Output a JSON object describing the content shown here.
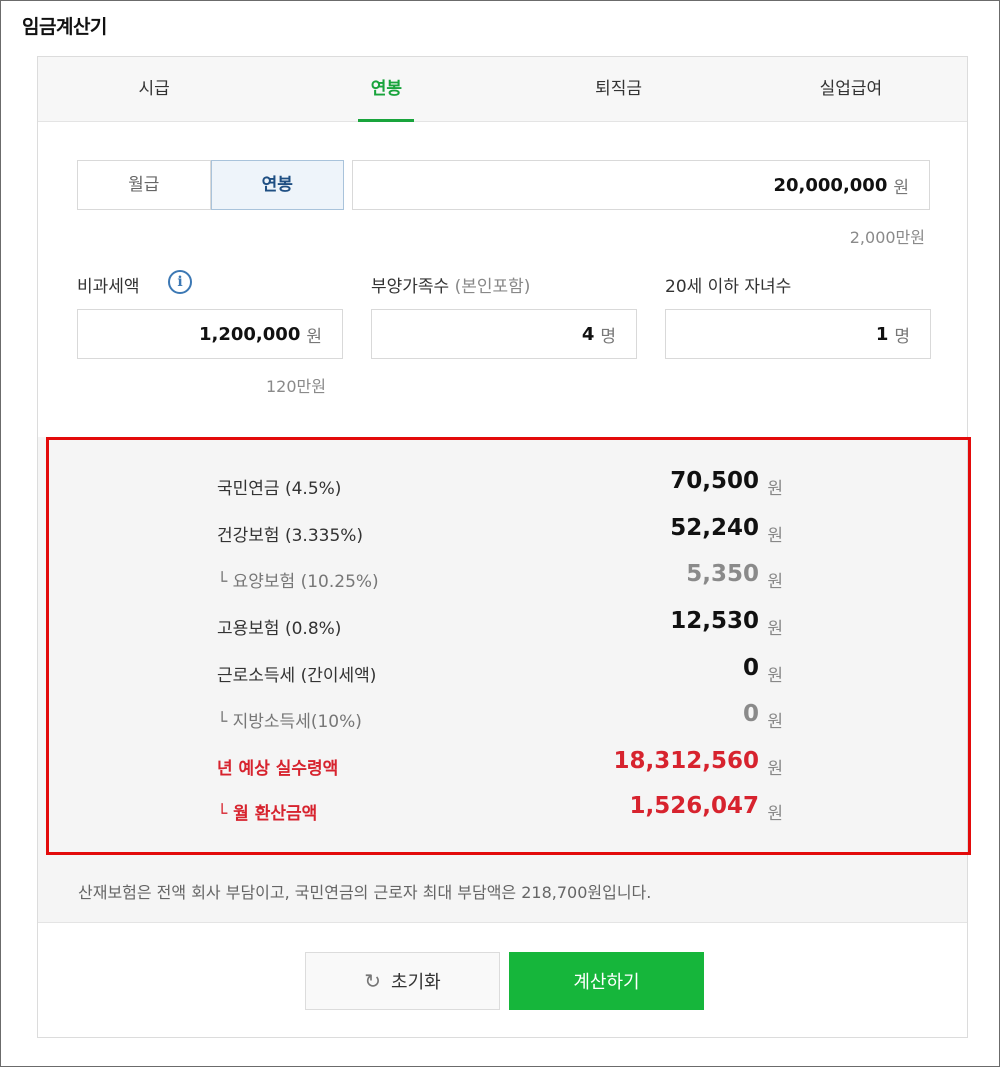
{
  "app_title": "임금계산기",
  "tabs": [
    {
      "label": "시급"
    },
    {
      "label": "연봉"
    },
    {
      "label": "퇴직금"
    },
    {
      "label": "실업급여"
    }
  ],
  "pay_type_toggle": {
    "monthly": "월급",
    "annual": "연봉"
  },
  "salary": {
    "value": "20,000,000",
    "unit": "원",
    "hint": "2,000만원"
  },
  "nontaxable": {
    "label": "비과세액",
    "info_icon": "i",
    "value": "1,200,000",
    "unit": "원",
    "hint": "120만원"
  },
  "dependents": {
    "label": "부양가족수",
    "sub_label": "(본인포함)",
    "value": "4",
    "unit": "명"
  },
  "children": {
    "label": "20세 이하 자녀수",
    "value": "1",
    "unit": "명"
  },
  "results": {
    "unit": "원",
    "rows": [
      {
        "label": "국민연금 (4.5%)",
        "value": "70,500"
      },
      {
        "label": "건강보험 (3.335%)",
        "value": "52,240"
      },
      {
        "label": "└ 요양보험 (10.25%)",
        "value": "5,350"
      },
      {
        "label": "고용보험 (0.8%)",
        "value": "12,530"
      },
      {
        "label": "근로소득세 (간이세액)",
        "value": "0"
      },
      {
        "label": "└ 지방소득세(10%)",
        "value": "0"
      },
      {
        "label": "년 예상 실수령액",
        "value": "18,312,560"
      },
      {
        "label": "└ 월 환산금액",
        "value": "1,526,047"
      }
    ]
  },
  "footnote": "산재보험은 전액 회사 부담이고, 국민연금의 근로자 최대 부담액은 218,700원입니다.",
  "buttons": {
    "reset_icon": "↻",
    "reset": "초기화",
    "calculate": "계산하기"
  },
  "colors": {
    "accent_green": "#16b63b",
    "result_red": "#d7232e",
    "highlight_border": "#e30b0b"
  }
}
